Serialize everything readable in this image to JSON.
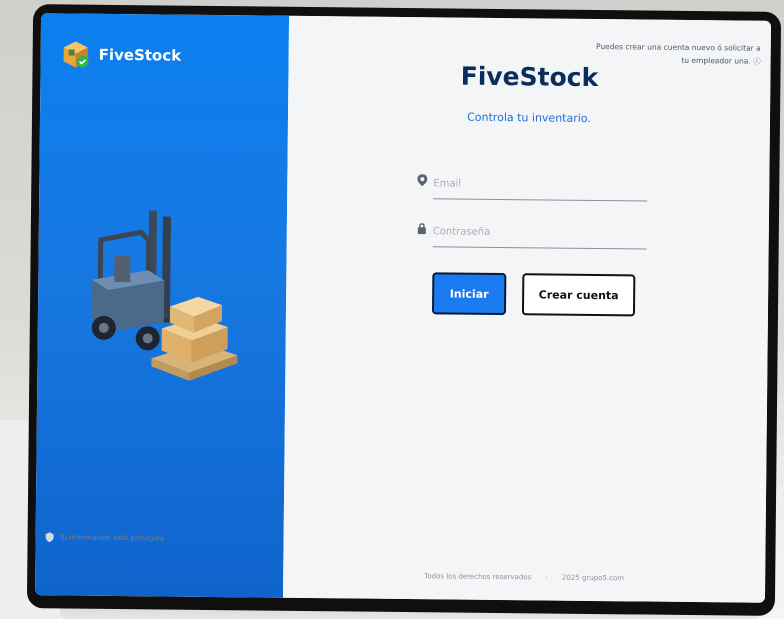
{
  "brand": {
    "name": "FiveStock",
    "primary_color": "#1a7af0",
    "panel_color": "#0c7ff0",
    "title_color": "#0b2d5b"
  },
  "header": {
    "hint": "Puedes crear una cuenta nuevo ó solicitar a tu empleador una. ⓘ"
  },
  "login": {
    "title": "FiveStock",
    "subtitle": "Controla tu inventario.",
    "email_placeholder": "Email",
    "email_icon": "location-pin-icon",
    "password_placeholder": "Contraseña",
    "password_icon": "lock-icon",
    "login_button": "Iniciar",
    "register_button": "Crear cuenta"
  },
  "left_panel": {
    "illustration": "forklift-boxes-illustration",
    "security_note": "Tu información está protegida"
  },
  "footer": {
    "rights": "Todos los derechos reservados",
    "separator": "·",
    "copyright": "2025 grupo5.com"
  }
}
